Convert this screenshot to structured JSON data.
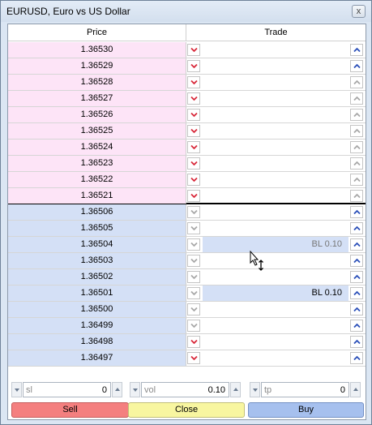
{
  "window": {
    "title": "EURUSD, Euro vs US Dollar",
    "close_glyph": "x"
  },
  "table": {
    "headers": {
      "price": "Price",
      "trade": "Trade"
    },
    "ask_rows": [
      {
        "price": "1.36530",
        "order": "",
        "sell_active": true,
        "buy_active": true
      },
      {
        "price": "1.36529",
        "order": "",
        "sell_active": true,
        "buy_active": true
      },
      {
        "price": "1.36528",
        "order": "",
        "sell_active": true,
        "buy_active": false
      },
      {
        "price": "1.36527",
        "order": "",
        "sell_active": true,
        "buy_active": false
      },
      {
        "price": "1.36526",
        "order": "",
        "sell_active": true,
        "buy_active": false
      },
      {
        "price": "1.36525",
        "order": "",
        "sell_active": true,
        "buy_active": false
      },
      {
        "price": "1.36524",
        "order": "",
        "sell_active": true,
        "buy_active": false
      },
      {
        "price": "1.36523",
        "order": "",
        "sell_active": true,
        "buy_active": false
      },
      {
        "price": "1.36522",
        "order": "",
        "sell_active": true,
        "buy_active": false
      },
      {
        "price": "1.36521",
        "order": "",
        "sell_active": true,
        "buy_active": false
      }
    ],
    "bid_rows": [
      {
        "price": "1.36506",
        "order": "",
        "sell_active": false,
        "buy_active": true
      },
      {
        "price": "1.36505",
        "order": "",
        "sell_active": false,
        "buy_active": true
      },
      {
        "price": "1.36504",
        "order": "BL 0.10",
        "order_style": "gray",
        "sell_active": false,
        "buy_active": true
      },
      {
        "price": "1.36503",
        "order": "",
        "sell_active": false,
        "buy_active": true
      },
      {
        "price": "1.36502",
        "order": "",
        "sell_active": false,
        "buy_active": true
      },
      {
        "price": "1.36501",
        "order": "BL 0.10",
        "order_style": "dark",
        "sell_active": false,
        "buy_active": true
      },
      {
        "price": "1.36500",
        "order": "",
        "sell_active": false,
        "buy_active": true
      },
      {
        "price": "1.36499",
        "order": "",
        "sell_active": false,
        "buy_active": true
      },
      {
        "price": "1.36498",
        "order": "",
        "sell_active": true,
        "buy_active": true
      },
      {
        "price": "1.36497",
        "order": "",
        "sell_active": true,
        "buy_active": true
      }
    ]
  },
  "fields": {
    "sl": {
      "label": "sl",
      "value": "0"
    },
    "vol": {
      "label": "vol",
      "value": "0.10"
    },
    "tp": {
      "label": "tp",
      "value": "0"
    }
  },
  "actions": {
    "sell": "Sell",
    "close": "Close",
    "buy": "Buy"
  },
  "colors": {
    "ask_bg": "#fde4f7",
    "bid_bg": "#d4e0f6",
    "sell_chevron": "#d8283a",
    "buy_chevron": "#2a4fb8",
    "inactive_chevron": "#a8a8a8",
    "sell_button": "#f47f7f",
    "close_button": "#f8f6a0",
    "buy_button": "#a6c0ee"
  },
  "icons": {
    "sell": "chevron-down-icon",
    "buy": "chevron-up-icon",
    "cursor": "move-cursor-icon"
  }
}
